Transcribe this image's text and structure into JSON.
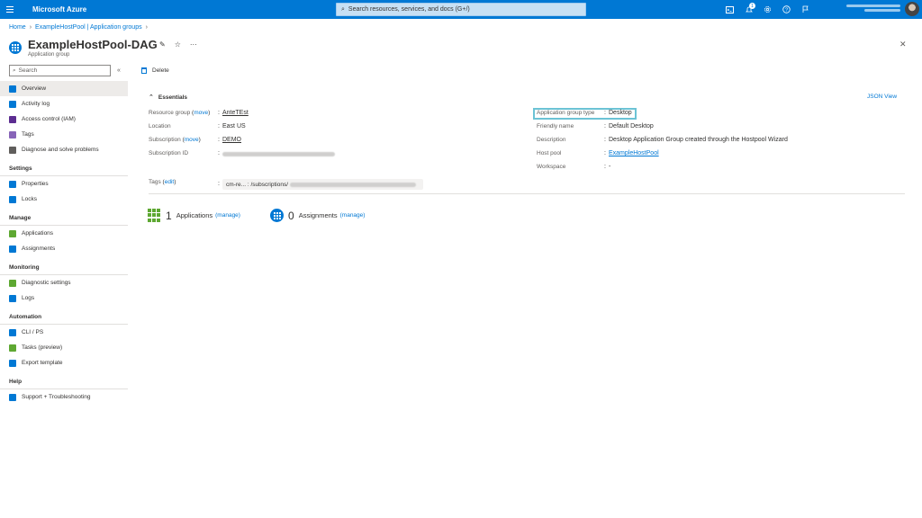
{
  "topbar": {
    "brand": "Microsoft Azure",
    "search_placeholder": "Search resources, services, and docs (G+/)",
    "notification_count": "1"
  },
  "breadcrumb": {
    "home": "Home",
    "parent": "ExampleHostPool | Application groups"
  },
  "header": {
    "title": "ExampleHostPool-DAG",
    "subtitle": "Application group"
  },
  "sidebar": {
    "search_placeholder": "Search",
    "collapse_label": "«",
    "items_top": [
      {
        "label": "Overview",
        "color": "#0078d4"
      },
      {
        "label": "Activity log",
        "color": "#0078d4"
      },
      {
        "label": "Access control (IAM)",
        "color": "#5c2d91"
      },
      {
        "label": "Tags",
        "color": "#8764b8"
      },
      {
        "label": "Diagnose and solve problems",
        "color": "#605e5c"
      }
    ],
    "sections": [
      {
        "title": "Settings",
        "items": [
          {
            "label": "Properties",
            "color": "#0078d4"
          },
          {
            "label": "Locks",
            "color": "#0078d4"
          }
        ]
      },
      {
        "title": "Manage",
        "items": [
          {
            "label": "Applications",
            "color": "#5ea832"
          },
          {
            "label": "Assignments",
            "color": "#0078d4"
          }
        ]
      },
      {
        "title": "Monitoring",
        "items": [
          {
            "label": "Diagnostic settings",
            "color": "#5ea832"
          },
          {
            "label": "Logs",
            "color": "#0078d4"
          }
        ]
      },
      {
        "title": "Automation",
        "items": [
          {
            "label": "CLI / PS",
            "color": "#0078d4"
          },
          {
            "label": "Tasks (preview)",
            "color": "#5ea832"
          },
          {
            "label": "Export template",
            "color": "#0078d4"
          }
        ]
      },
      {
        "title": "Help",
        "items": [
          {
            "label": "Support + Troubleshooting",
            "color": "#0078d4"
          }
        ]
      }
    ]
  },
  "toolbar": {
    "delete_label": "Delete"
  },
  "essentials": {
    "title": "Essentials",
    "json_view": "JSON View",
    "left": {
      "resource_group_label": "Resource group",
      "resource_group_move": "move",
      "resource_group_value": "AnteTEst",
      "location_label": "Location",
      "location_value": "East US",
      "subscription_label": "Subscription",
      "subscription_move": "move",
      "subscription_value": "DEMO",
      "subscription_id_label": "Subscription ID",
      "tags_label": "Tags",
      "tags_edit": "edit",
      "tag_key": "cm-re...",
      "tag_value": ": /subscriptions/"
    },
    "right": {
      "app_group_type_label": "Application group type",
      "app_group_type_value": "Desktop",
      "friendly_name_label": "Friendly name",
      "friendly_name_value": "Default Desktop",
      "description_label": "Description",
      "description_value": "Desktop Application Group created through the Hostpool Wizard",
      "host_pool_label": "Host pool",
      "host_pool_value": "ExampleHostPool",
      "workspace_label": "Workspace",
      "workspace_value": "-"
    }
  },
  "stats": {
    "applications_count": "1",
    "applications_label": "Applications",
    "assignments_count": "0",
    "assignments_label": "Assignments",
    "manage_label": "(manage)"
  }
}
